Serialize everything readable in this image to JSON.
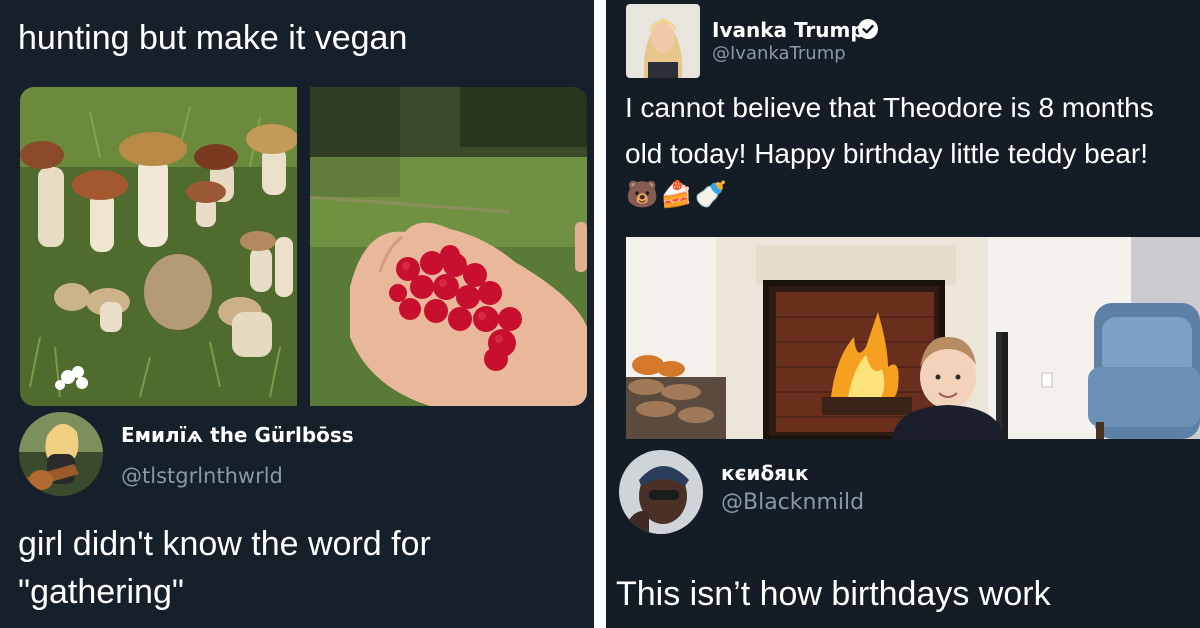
{
  "left_post": {
    "caption": "hunting but make it vegan",
    "user_name": "Емилїѧ the Gürlbōss",
    "user_handle": "@tlstgrlnthwrld",
    "reply_text_line1": "girl didn't know the word for",
    "reply_text_line2": "\"gathering\""
  },
  "right_post": {
    "author_name": "Ivanka Trump",
    "author_handle": "@IvankaTrump",
    "tweet_line1": "I cannot believe that Theodore is 8 months",
    "tweet_line2": "old today! Happy birthday little teddy bear!",
    "tweet_emojis": "🐻🍰🍼",
    "reply_name": "кєиδяιк",
    "reply_handle": "@Blacknmild",
    "reply_text": "This isn’t how birthdays work"
  },
  "colors": {
    "background": "#15202b",
    "text": "#ffffff",
    "secondary_text": "#8899a6",
    "verified": "#ffffff"
  },
  "icons": [
    "verified-badge-icon"
  ]
}
